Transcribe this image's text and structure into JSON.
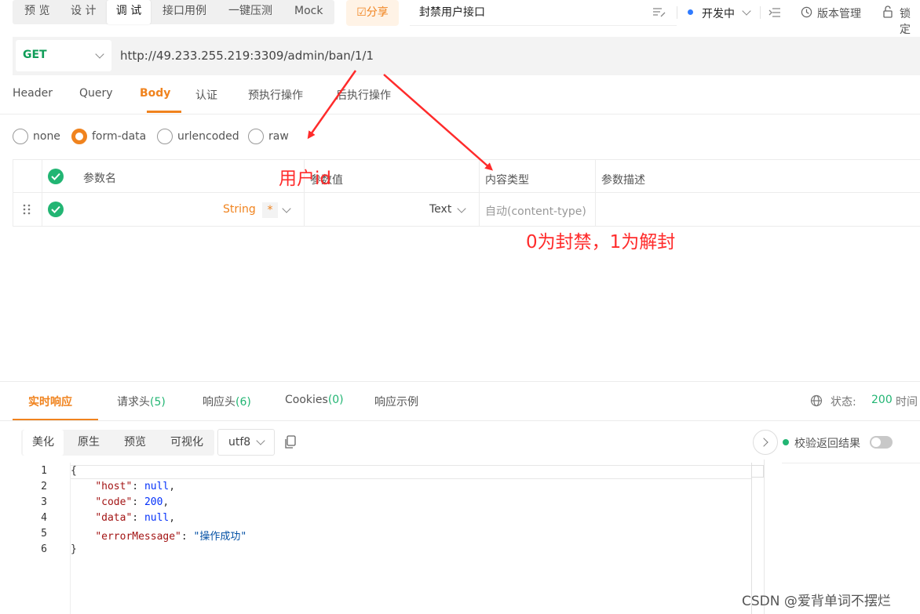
{
  "modes": [
    "预 览",
    "设 计",
    "调 试",
    "接口用例",
    "一键压测",
    "Mock"
  ],
  "share_label": "☑分享",
  "api_name": "封禁用户接口",
  "env": {
    "label": "开发中"
  },
  "version_label": "版本管理",
  "lock_label": "锁定",
  "method": "GET",
  "url": "http://49.233.255.219:3309/admin/ban/1/1",
  "request_tabs": [
    "Header",
    "Query",
    "Body",
    "认证",
    "预执行操作",
    "后执行操作"
  ],
  "body_types": [
    "none",
    "form-data",
    "urlencoded",
    "raw"
  ],
  "param_table": {
    "headers": [
      "参数名",
      "参数值",
      "内容类型",
      "参数描述"
    ],
    "row": {
      "type": "String",
      "required": "*",
      "value_type": "Text",
      "content_type": "自动(content-type)"
    }
  },
  "annotations": {
    "user_id": "用户id",
    "ban_note": "0为封禁，1为解封"
  },
  "response_tabs": [
    {
      "label": "实时响应",
      "count": ""
    },
    {
      "label": "请求头",
      "count": "(5)"
    },
    {
      "label": "响应头",
      "count": "(6)"
    },
    {
      "label": "Cookies",
      "count": "(0)"
    },
    {
      "label": "响应示例",
      "count": ""
    }
  ],
  "status": {
    "label": "状态:",
    "code": "200",
    "time_label": "时间"
  },
  "format_buttons": [
    "美化",
    "原生",
    "预览",
    "可视化"
  ],
  "encoding": "utf8",
  "validate_label": "校验返回结果",
  "code_lines": [
    {
      "no": "1",
      "parts": [
        [
          "p",
          "{"
        ]
      ]
    },
    {
      "no": "2",
      "parts": [
        [
          "p",
          "    "
        ],
        [
          "k",
          "\"host\""
        ],
        [
          "p",
          ": "
        ],
        [
          "v",
          "null"
        ],
        [
          "p",
          ","
        ]
      ]
    },
    {
      "no": "3",
      "parts": [
        [
          "p",
          "    "
        ],
        [
          "k",
          "\"code\""
        ],
        [
          "p",
          ": "
        ],
        [
          "v",
          "200"
        ],
        [
          "p",
          ","
        ]
      ]
    },
    {
      "no": "4",
      "parts": [
        [
          "p",
          "    "
        ],
        [
          "k",
          "\"data\""
        ],
        [
          "p",
          ": "
        ],
        [
          "v",
          "null"
        ],
        [
          "p",
          ","
        ]
      ]
    },
    {
      "no": "5",
      "parts": [
        [
          "p",
          "    "
        ],
        [
          "k",
          "\"errorMessage\""
        ],
        [
          "p",
          ": "
        ],
        [
          "s",
          "\"操作成功\""
        ]
      ]
    },
    {
      "no": "6",
      "parts": [
        [
          "p",
          "}"
        ]
      ]
    }
  ],
  "watermark": "CSDN @爱背单词不摆烂",
  "colors": {
    "accent": "#f0831e",
    "success": "#22b573",
    "annotation": "#ff2b2b",
    "method": "#0f9d58"
  }
}
